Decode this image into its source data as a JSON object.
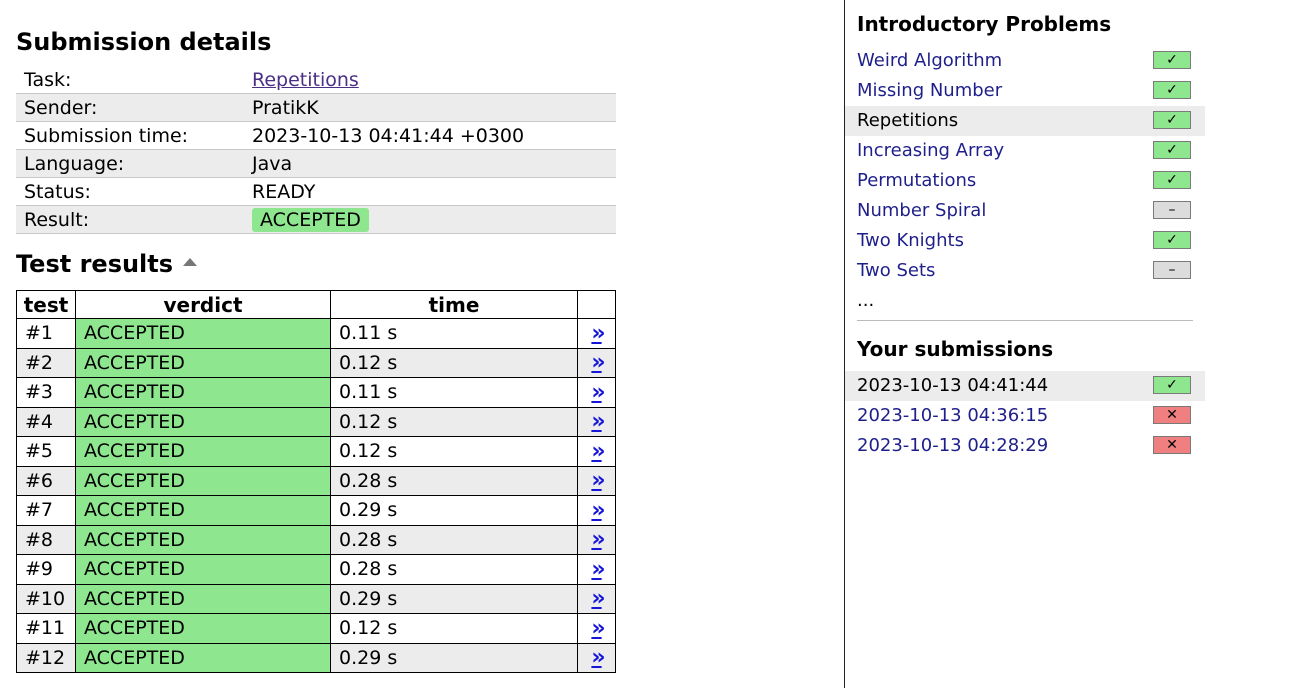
{
  "submission": {
    "heading": "Submission details",
    "rows": [
      {
        "label": "Task:",
        "value": "Repetitions"
      },
      {
        "label": "Sender:",
        "value": "PratikK"
      },
      {
        "label": "Submission time:",
        "value": "2023-10-13 04:41:44 +0300"
      },
      {
        "label": "Language:",
        "value": "Java"
      },
      {
        "label": "Status:",
        "value": "READY"
      },
      {
        "label": "Result:",
        "value": "ACCEPTED"
      }
    ]
  },
  "tests": {
    "heading": "Test results",
    "columns": [
      "test",
      "verdict",
      "time"
    ],
    "link_glyph": "»",
    "rows": [
      {
        "test": "#1",
        "verdict": "ACCEPTED",
        "time": "0.11 s"
      },
      {
        "test": "#2",
        "verdict": "ACCEPTED",
        "time": "0.12 s"
      },
      {
        "test": "#3",
        "verdict": "ACCEPTED",
        "time": "0.11 s"
      },
      {
        "test": "#4",
        "verdict": "ACCEPTED",
        "time": "0.12 s"
      },
      {
        "test": "#5",
        "verdict": "ACCEPTED",
        "time": "0.12 s"
      },
      {
        "test": "#6",
        "verdict": "ACCEPTED",
        "time": "0.28 s"
      },
      {
        "test": "#7",
        "verdict": "ACCEPTED",
        "time": "0.29 s"
      },
      {
        "test": "#8",
        "verdict": "ACCEPTED",
        "time": "0.28 s"
      },
      {
        "test": "#9",
        "verdict": "ACCEPTED",
        "time": "0.28 s"
      },
      {
        "test": "#10",
        "verdict": "ACCEPTED",
        "time": "0.29 s"
      },
      {
        "test": "#11",
        "verdict": "ACCEPTED",
        "time": "0.12 s"
      },
      {
        "test": "#12",
        "verdict": "ACCEPTED",
        "time": "0.29 s"
      }
    ]
  },
  "sidebar": {
    "problems_heading": "Introductory Problems",
    "problems": [
      {
        "name": "Weird Algorithm",
        "status": "ok",
        "current": false
      },
      {
        "name": "Missing Number",
        "status": "ok",
        "current": false
      },
      {
        "name": "Repetitions",
        "status": "ok",
        "current": true
      },
      {
        "name": "Increasing Array",
        "status": "ok",
        "current": false
      },
      {
        "name": "Permutations",
        "status": "ok",
        "current": false
      },
      {
        "name": "Number Spiral",
        "status": "none",
        "current": false
      },
      {
        "name": "Two Knights",
        "status": "ok",
        "current": false
      },
      {
        "name": "Two Sets",
        "status": "none",
        "current": false
      }
    ],
    "ellipsis": "...",
    "submissions_heading": "Your submissions",
    "submissions": [
      {
        "time": "2023-10-13 04:41:44",
        "status": "ok",
        "current": true
      },
      {
        "time": "2023-10-13 04:36:15",
        "status": "fail",
        "current": false
      },
      {
        "time": "2023-10-13 04:28:29",
        "status": "fail",
        "current": false
      }
    ],
    "status_glyphs": {
      "ok": "✓",
      "none": "–",
      "fail": "✕"
    }
  },
  "colors": {
    "accepted": "#8ee68e",
    "failed": "#f08080",
    "link": "#1f1f8c"
  }
}
